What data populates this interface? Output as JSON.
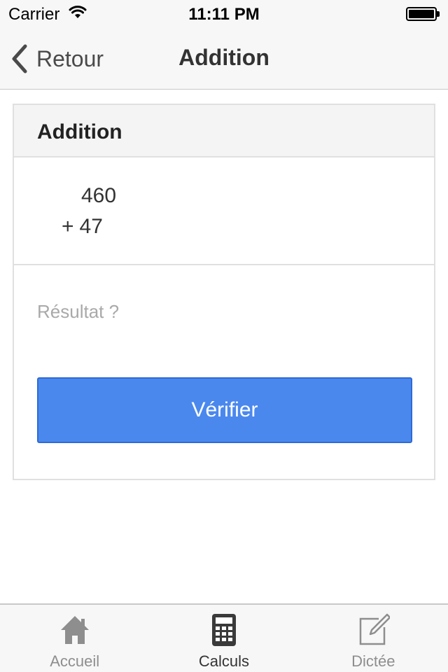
{
  "status_bar": {
    "carrier": "Carrier",
    "time": "11:11 PM",
    "wifi_icon": "wifi-icon",
    "battery_icon": "battery-full-icon"
  },
  "nav": {
    "back_label": "Retour",
    "back_icon": "chevron-left-icon",
    "title": "Addition"
  },
  "panel": {
    "title": "Addition",
    "operation": {
      "operand_1": "460",
      "operator": "+",
      "operand_2": "47"
    },
    "result": {
      "value": "",
      "placeholder": "Résultat ?"
    },
    "verify_label": "Vérifier"
  },
  "tab_bar": {
    "tabs": [
      {
        "label": "Accueil",
        "icon": "home-icon",
        "active": false
      },
      {
        "label": "Calculs",
        "icon": "calculator-icon",
        "active": true
      },
      {
        "label": "Dictée",
        "icon": "edit-note-icon",
        "active": false
      }
    ]
  },
  "colors": {
    "accent": "#4a88ee",
    "accent_border": "#2e6ad6",
    "bar_background": "#f7f7f7",
    "inactive_icon": "#8e8e8e",
    "active_icon": "#3a3a3a"
  }
}
